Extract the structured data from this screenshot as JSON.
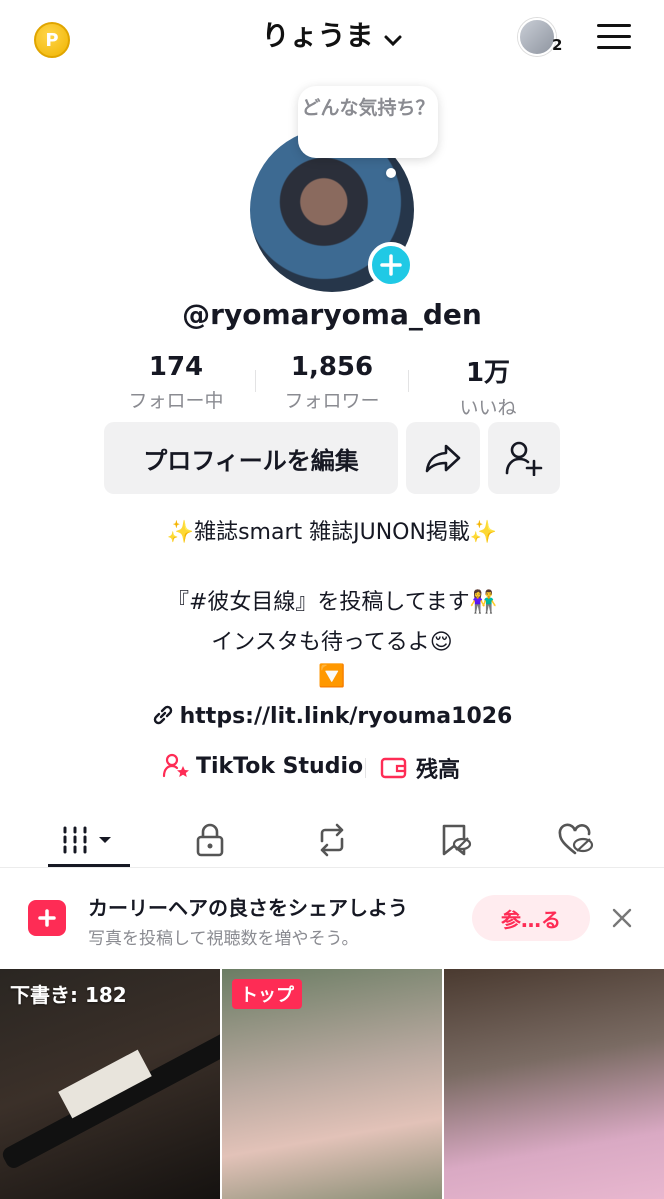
{
  "header": {
    "coin_icon": "coin-icon",
    "coin_glyph": "P",
    "account_name": "りょうま",
    "notification_count": "2"
  },
  "profile": {
    "mood_bubble": "どんな気持ち？",
    "username": "@ryomaryoma_den",
    "stats": [
      {
        "value": "174",
        "label": "フォロー中"
      },
      {
        "value": "1,856",
        "label": "フォロワー"
      },
      {
        "value": "1万",
        "label": "いいね"
      }
    ],
    "edit_profile_label": "プロフィールを編集"
  },
  "bio": {
    "line1": "✨雑誌smart 雑誌JUNON掲載✨",
    "line2": "『#彼女目線』を投稿してます👫",
    "line3": "インスタも待ってるよ😌",
    "line4": "🔽",
    "link": "https://lit.link/ryouma1026"
  },
  "tools": {
    "studio": "TikTok Studio",
    "balance": "残高"
  },
  "tabs": [
    {
      "icon": "grid-icon"
    },
    {
      "icon": "lock-icon"
    },
    {
      "icon": "repost-icon"
    },
    {
      "icon": "bookmark-icon"
    },
    {
      "icon": "liked-icon"
    }
  ],
  "banner": {
    "title": "カーリーヘアの良さをシェアしよう",
    "subtitle": "写真を投稿して視聴数を増やそう。",
    "button": "参…る"
  },
  "grid": {
    "draft_label": "下書き: 182",
    "top_badge": "トップ"
  },
  "colors": {
    "accent": "#fe2c55",
    "plus_button": "#20c9e5",
    "secondary_text": "#8a8b91"
  }
}
